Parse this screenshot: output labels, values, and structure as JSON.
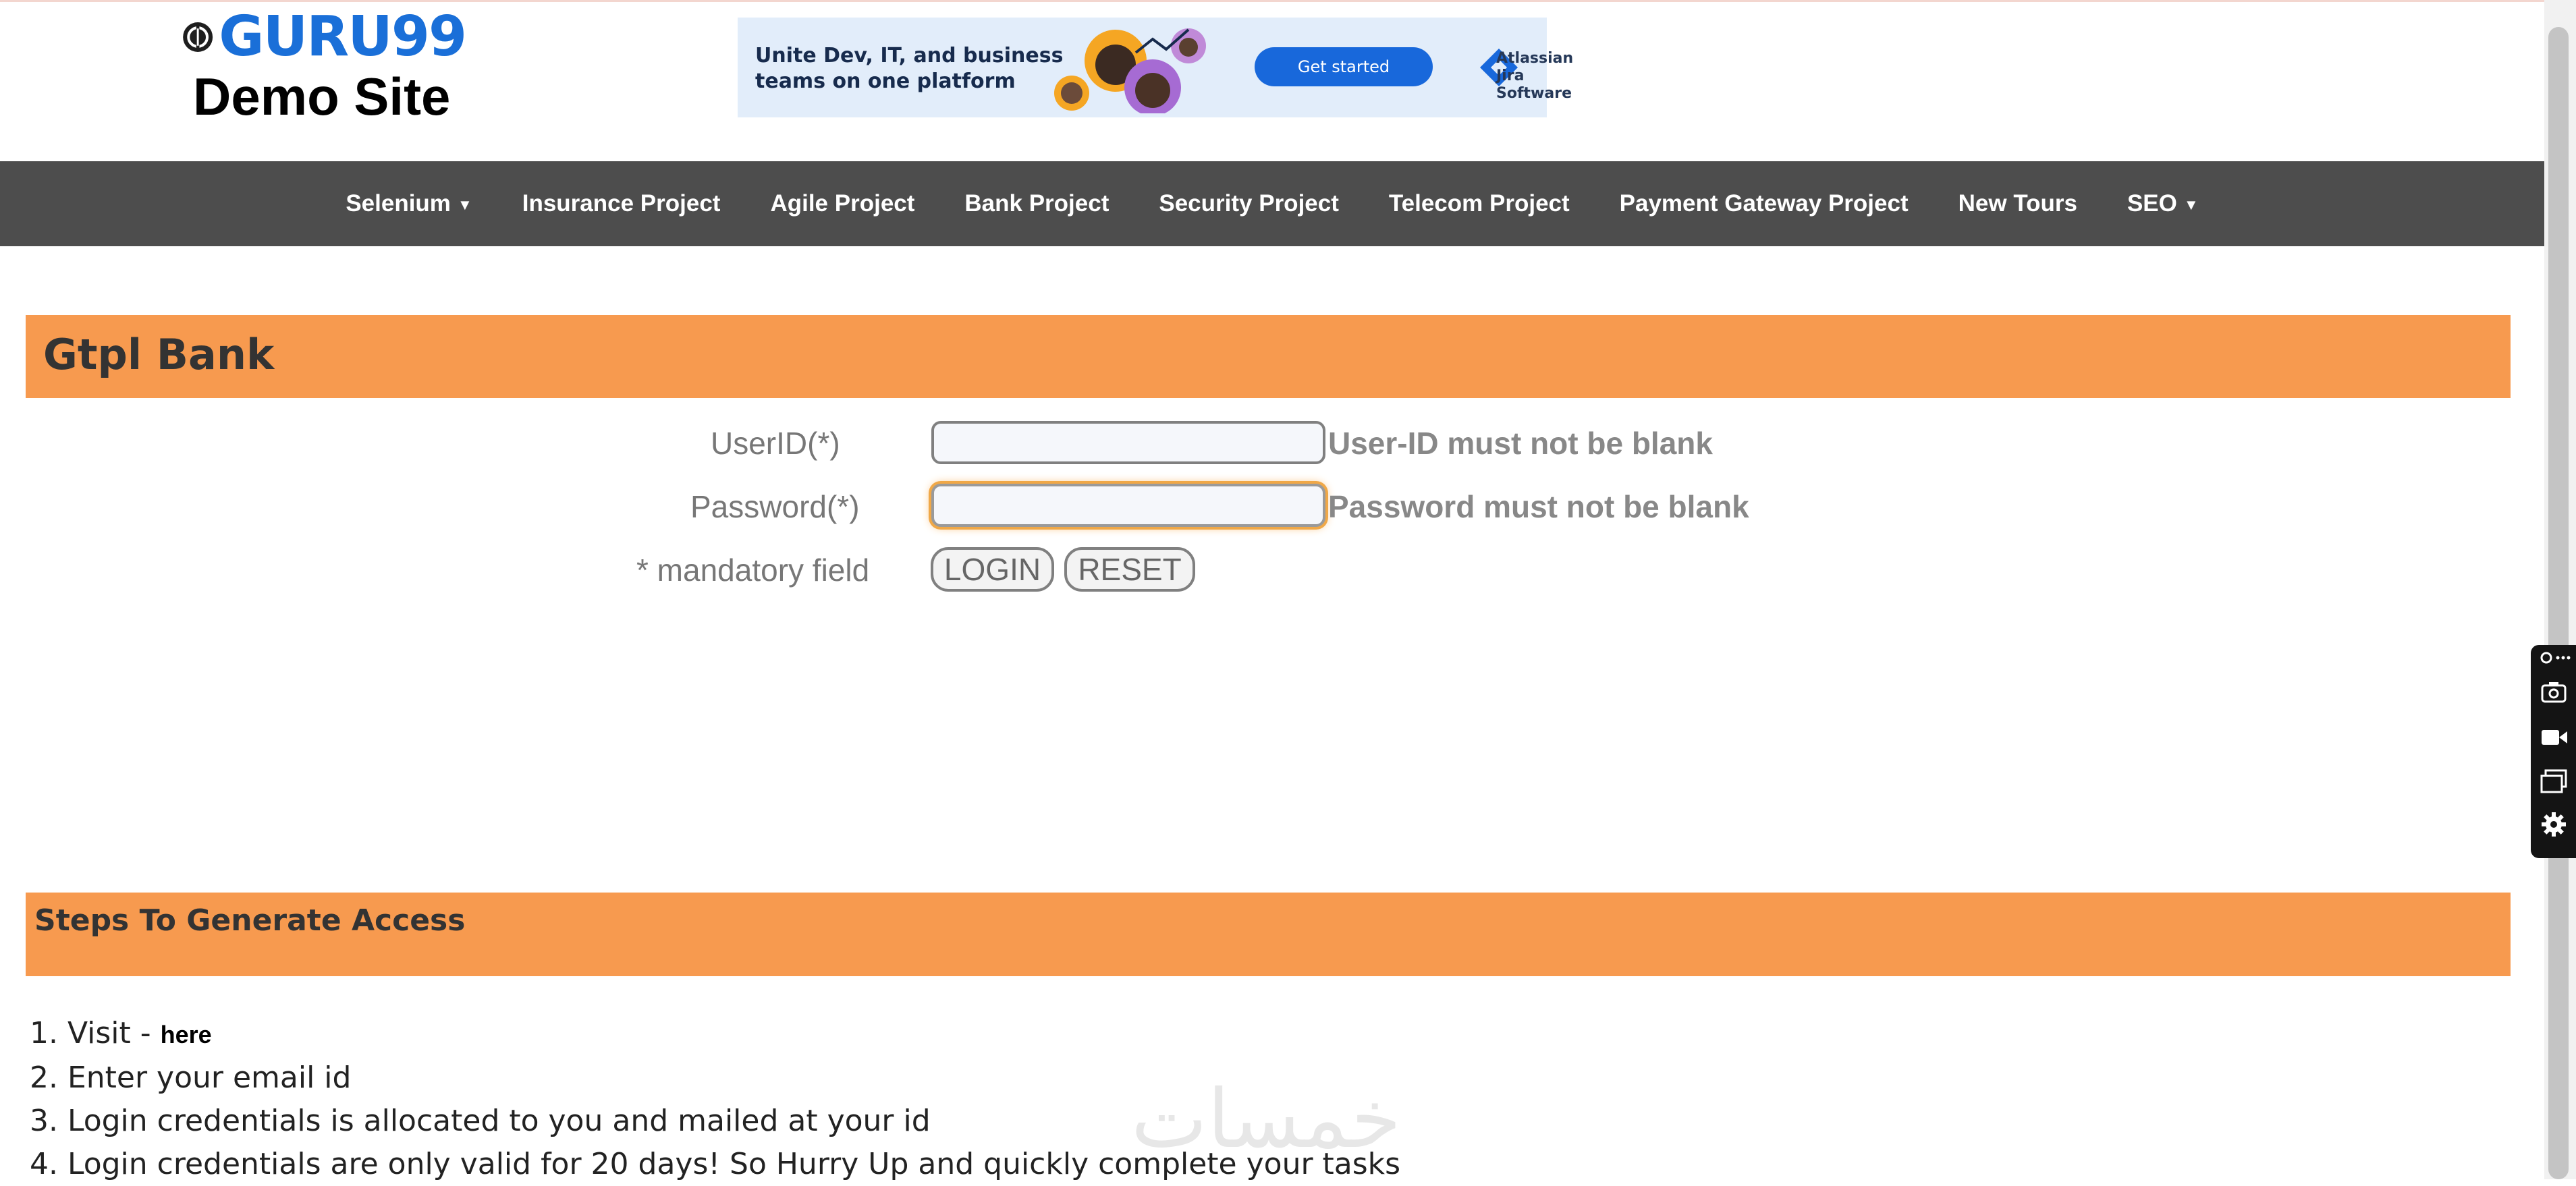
{
  "header": {
    "logo_text": "GURU99",
    "site_title": "Demo Site",
    "ad": {
      "headline_line1": "Unite Dev, IT, and business",
      "headline_line2": "teams on one platform",
      "cta": "Get started",
      "brand_line1": "Atlassian",
      "brand_line2": "Jira Software"
    }
  },
  "nav": {
    "items": [
      {
        "label": "Selenium",
        "dropdown": true
      },
      {
        "label": "Insurance Project"
      },
      {
        "label": "Agile Project"
      },
      {
        "label": "Bank Project"
      },
      {
        "label": "Security Project"
      },
      {
        "label": "Telecom Project"
      },
      {
        "label": "Payment Gateway Project"
      },
      {
        "label": "New Tours"
      },
      {
        "label": "SEO",
        "dropdown": true
      }
    ]
  },
  "login": {
    "bank_title": "Gtpl Bank",
    "userid_label": "UserID(*)",
    "userid_value": "",
    "userid_error": "User-ID must not be blank",
    "password_label": "Password(*)",
    "password_value": "",
    "password_error": "Password must not be blank",
    "mandatory_note": "* mandatory field",
    "login_label": "LOGIN",
    "reset_label": "RESET"
  },
  "steps": {
    "title": "Steps To Generate Access",
    "items": [
      {
        "text": "1. Visit - ",
        "link": "here"
      },
      {
        "text": "2. Enter your email id"
      },
      {
        "text": "3. Login credentials is allocated to you and mailed at your id"
      },
      {
        "text": "4. Login credentials are only valid for 20 days! So Hurry Up and quickly complete your tasks"
      }
    ]
  },
  "side_tools": [
    "link-icon",
    "camera-icon",
    "video-icon",
    "window-icon",
    "gear-icon"
  ],
  "watermark": "خمسات",
  "colors": {
    "accent_orange": "#f79a4f",
    "nav_bg": "#4d4d4d",
    "logo_blue": "#1a6fd8"
  }
}
